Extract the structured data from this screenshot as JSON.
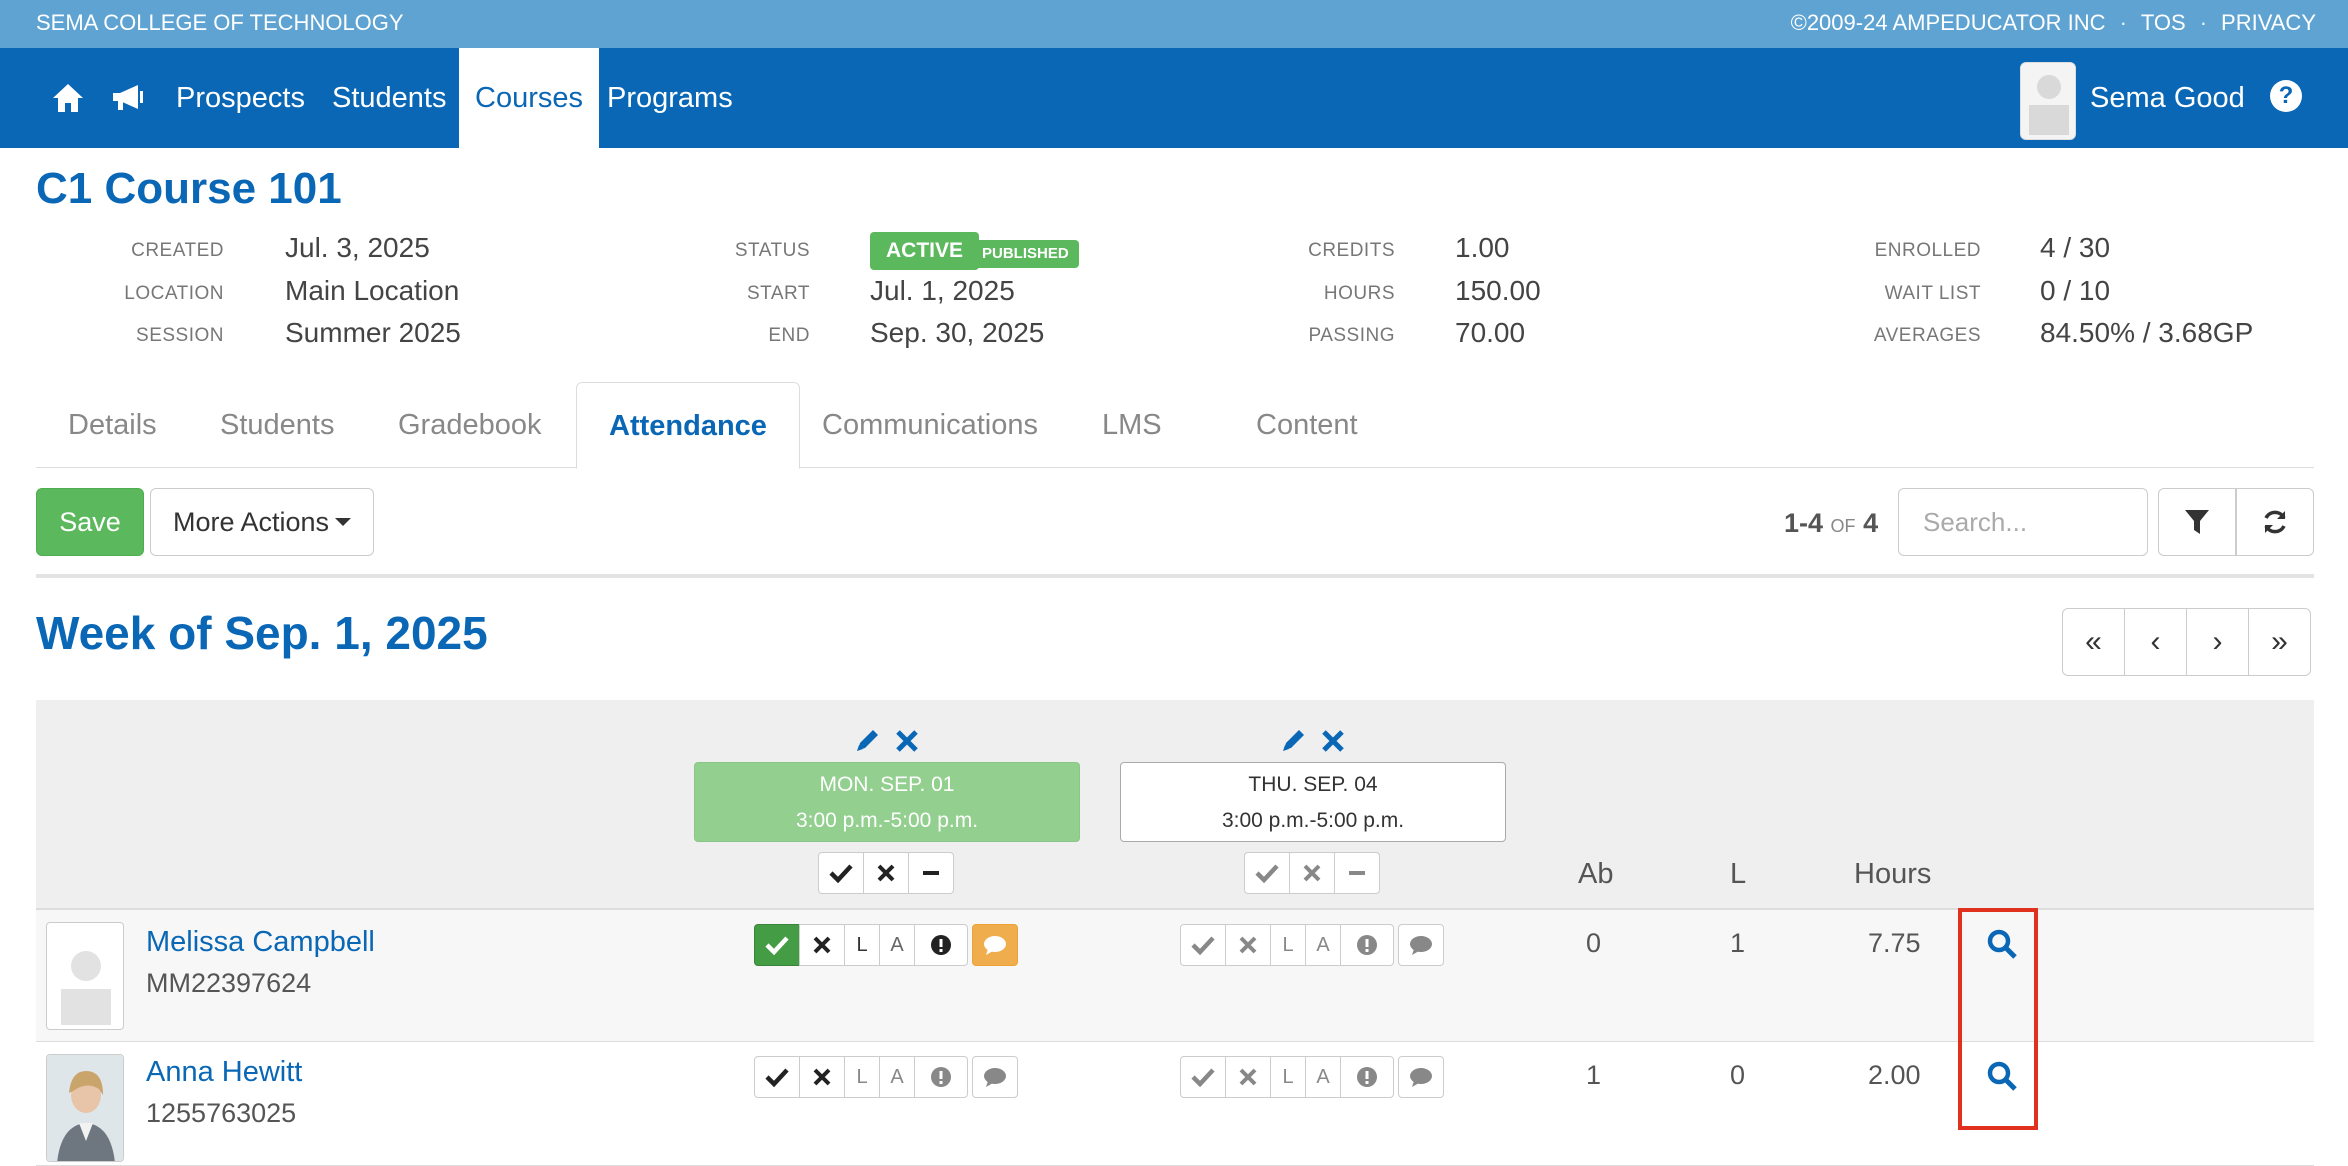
{
  "topbar": {
    "school": "SEMA COLLEGE OF TECHNOLOGY",
    "copyright": "©2009-24 AMPEDUCATOR INC",
    "tos": "TOS",
    "privacy": "PRIVACY",
    "sep": "·"
  },
  "nav": {
    "items": [
      "Prospects",
      "Students",
      "Courses",
      "Programs"
    ],
    "active": "Courses",
    "user_name": "Sema Good",
    "help": "?"
  },
  "course": {
    "title": "C1 Course 101",
    "meta": {
      "created_label": "CREATED",
      "created": "Jul. 3, 2025",
      "location_label": "LOCATION",
      "location": "Main Location",
      "session_label": "SESSION",
      "session": "Summer 2025",
      "status_label": "STATUS",
      "status": "ACTIVE",
      "published": "PUBLISHED",
      "start_label": "START",
      "start": "Jul. 1, 2025",
      "end_label": "END",
      "end": "Sep. 30, 2025",
      "credits_label": "CREDITS",
      "credits": "1.00",
      "hours_label": "HOURS",
      "hours": "150.00",
      "passing_label": "PASSING",
      "passing": "70.00",
      "enrolled_label": "ENROLLED",
      "enrolled": "4 / 30",
      "waitlist_label": "WAIT LIST",
      "waitlist": "0 / 10",
      "averages_label": "AVERAGES",
      "averages": "84.50% / 3.68GP"
    }
  },
  "tabs": [
    "Details",
    "Students",
    "Gradebook",
    "Attendance",
    "Communications",
    "LMS",
    "Content"
  ],
  "toolbar": {
    "save": "Save",
    "more_actions": "More Actions",
    "count_range": "1-4",
    "count_of": "OF",
    "count_total": "4",
    "search_placeholder": "Search..."
  },
  "week": {
    "title": "Week of Sep. 1, 2025",
    "pager": [
      "«",
      "‹",
      "›",
      "»"
    ]
  },
  "sessions": [
    {
      "day": "MON. SEP. 01",
      "time": "3:00 p.m.-5:00 p.m.",
      "active": true
    },
    {
      "day": "THU. SEP. 04",
      "time": "3:00 p.m.-5:00 p.m.",
      "active": false
    }
  ],
  "columns": {
    "ab": "Ab",
    "l": "L",
    "hours": "Hours"
  },
  "attendance_codes": {
    "late": "L",
    "absent_excused": "A"
  },
  "students": [
    {
      "name": "Melissa Campbell",
      "id": "MM22397624",
      "ab": "0",
      "l": "1",
      "hours": "7.75"
    },
    {
      "name": "Anna Hewitt",
      "id": "1255763025",
      "ab": "1",
      "l": "0",
      "hours": "2.00"
    }
  ],
  "colors": {
    "brand": "#0967b5",
    "topstrip": "#5ea3d1",
    "success": "#5cb85c",
    "highlight": "#e0301e"
  }
}
